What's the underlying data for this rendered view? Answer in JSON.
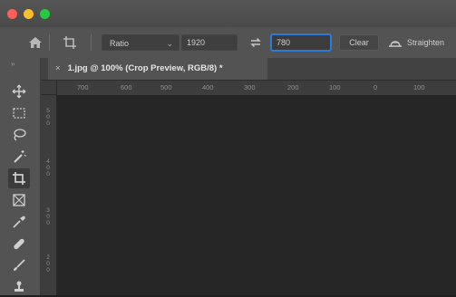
{
  "options_bar": {
    "ratio_label": "Ratio",
    "width_value": "1920",
    "height_value": "780",
    "clear_label": "Clear",
    "straighten_label": "Straighten"
  },
  "document": {
    "tab_title": "1.jpg @ 100% (Crop Preview, RGB/8) *"
  },
  "ruler": {
    "h_labels": [
      "700",
      "600",
      "500",
      "400",
      "300",
      "200",
      "100",
      "0",
      "100"
    ],
    "v_labels": [
      "500",
      "400",
      "300",
      "200"
    ]
  },
  "icons": [
    "home-icon",
    "crop-tool-preset-icon",
    "swap-icon",
    "straighten-icon",
    "move-icon",
    "marquee-icon",
    "lasso-icon",
    "magic-wand-icon",
    "crop-icon",
    "frame-icon",
    "eyedropper-icon",
    "healing-brush-icon",
    "brush-icon",
    "clone-stamp-icon"
  ],
  "colors": {
    "focus_accent": "#2d7bd8",
    "close_dot": "#fe5f57",
    "minimize_dot": "#febc2e",
    "maximize_dot": "#28c840"
  }
}
